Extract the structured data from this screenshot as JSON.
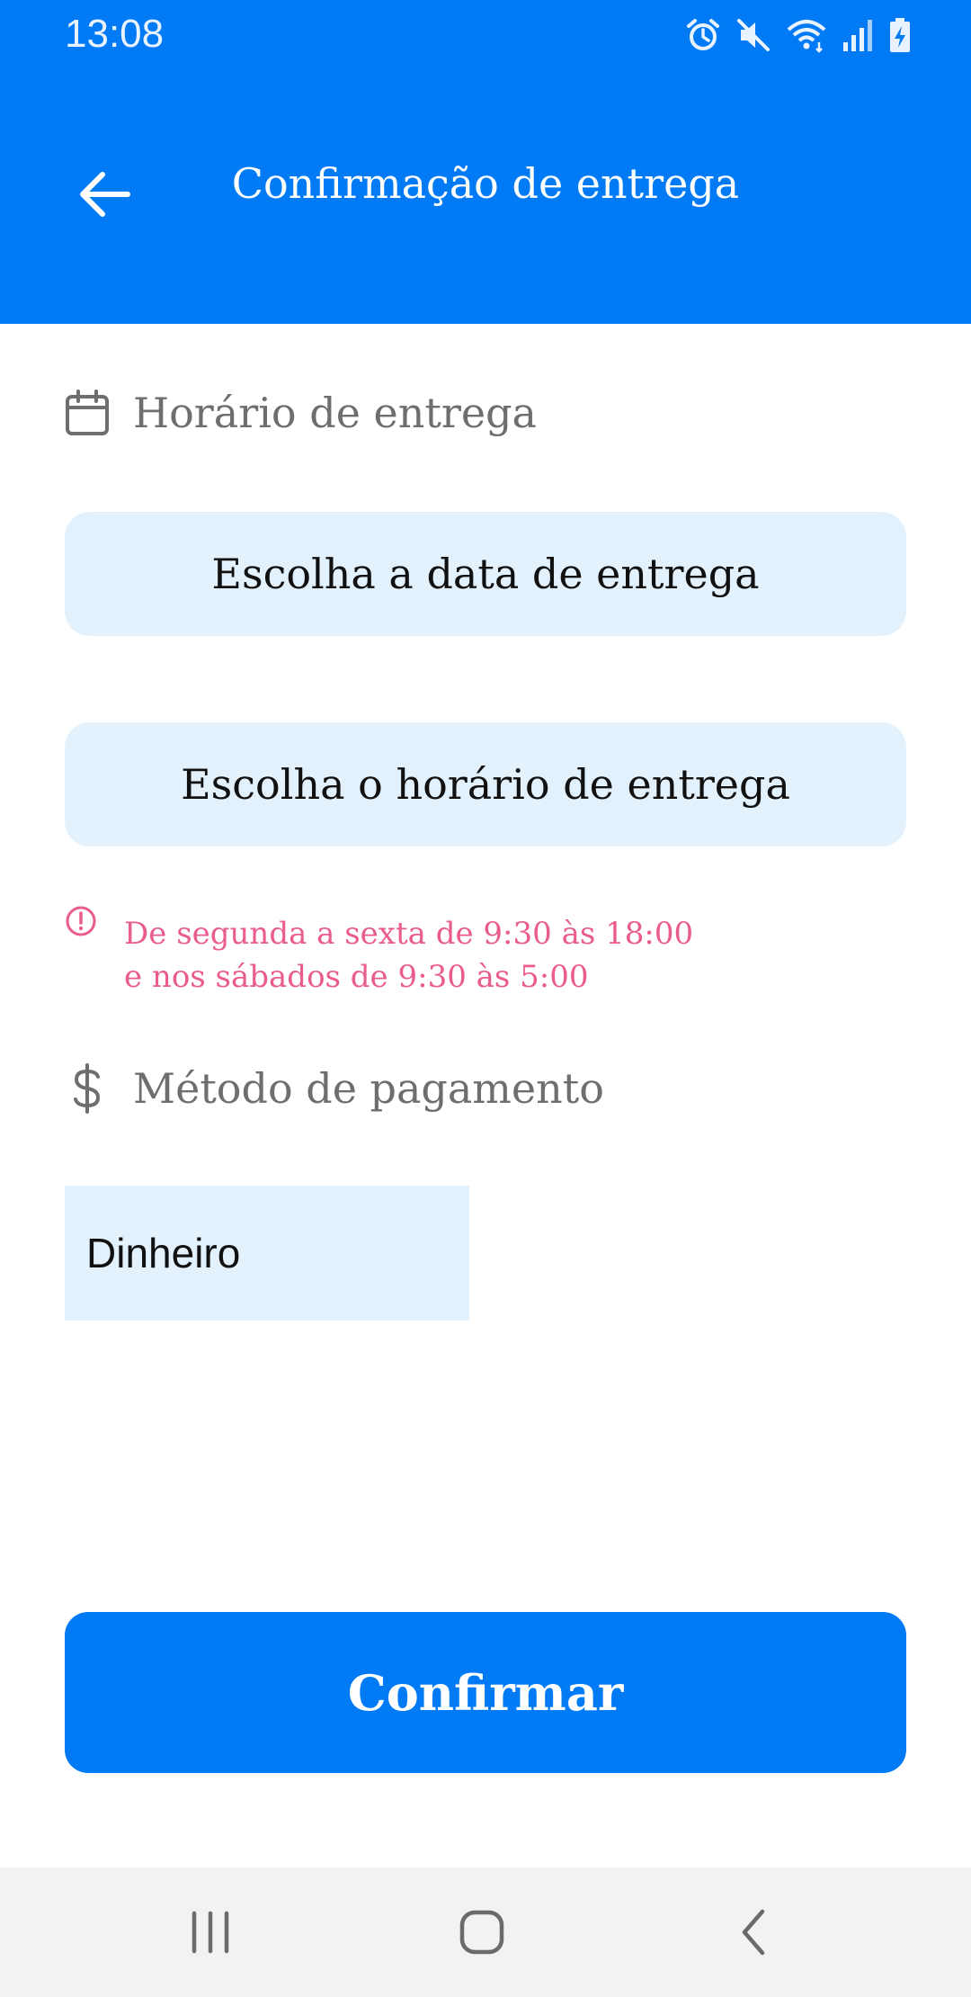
{
  "status_bar": {
    "time": "13:08",
    "icons": [
      "alarm-icon",
      "mute-icon",
      "wifi-icon",
      "signal-icon",
      "battery-charging-icon"
    ]
  },
  "app_bar": {
    "title": "Confirmação de entrega",
    "back_icon": "arrow-left-icon",
    "color": "#007bf5"
  },
  "delivery_section": {
    "icon": "calendar-icon",
    "label": "Horário de entrega",
    "date_button": "Escolha a data de entrega",
    "time_button": "Escolha o horário de entrega"
  },
  "notice": {
    "icon": "alert-circle-icon",
    "line1": "De segunda a sexta de 9:30 às 18:00",
    "line2": "e nos sábados de 9:30 às 5:00",
    "color": "#ea5b90"
  },
  "payment_section": {
    "icon": "dollar-icon",
    "label": "Método de pagamento",
    "selected_value": "Dinheiro"
  },
  "confirm_button": {
    "label": "Confirmar"
  },
  "nav_bar": {
    "items": [
      "recents-icon",
      "home-icon",
      "back-icon"
    ]
  }
}
